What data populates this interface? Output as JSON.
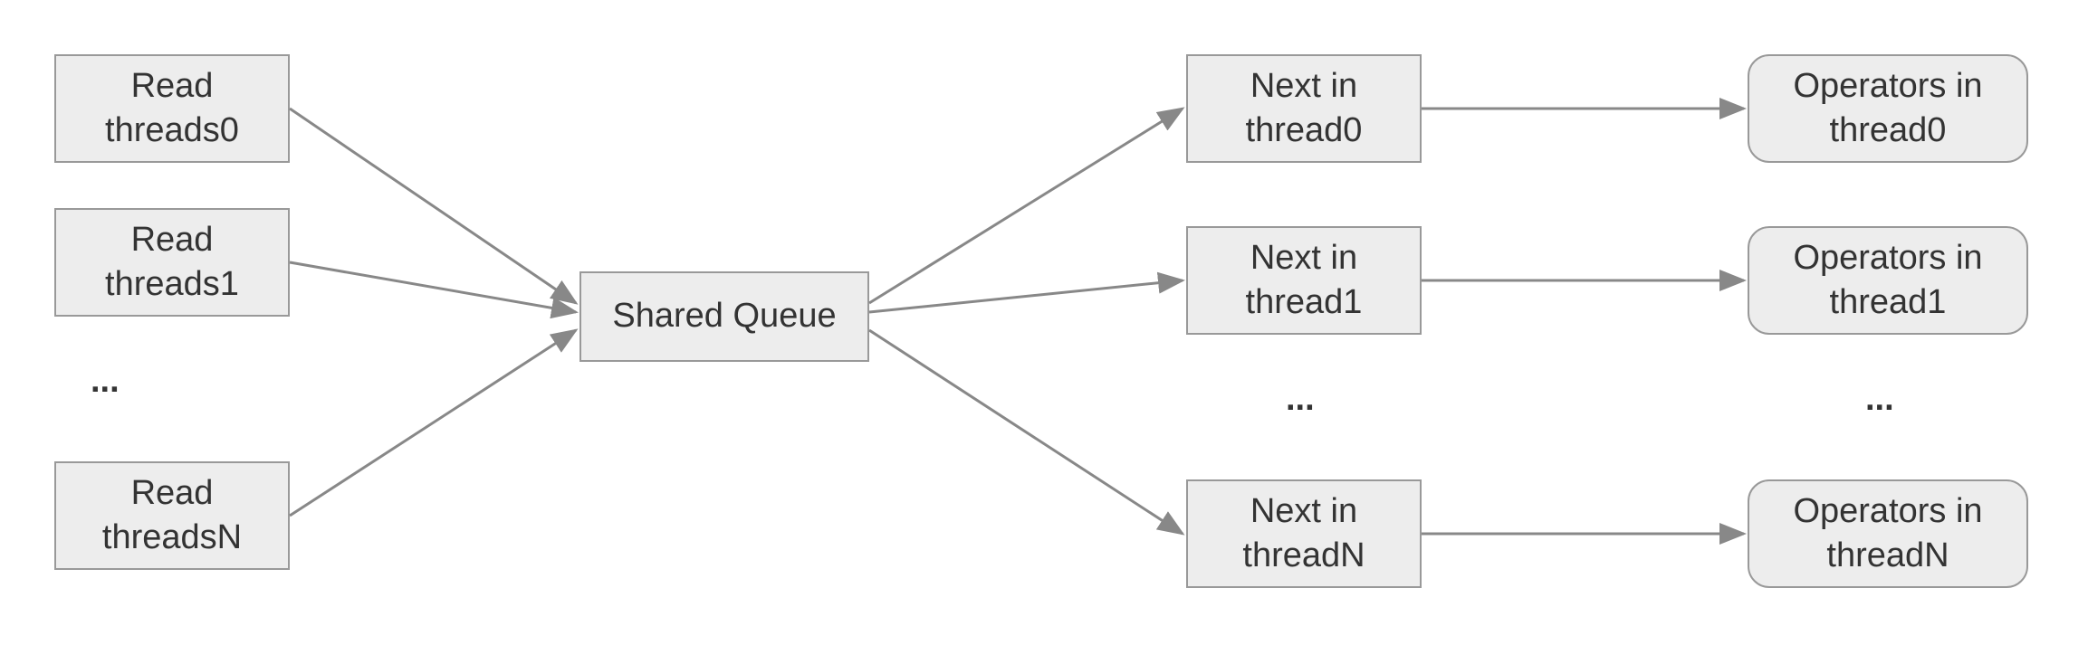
{
  "read_column": {
    "items": [
      {
        "line1": "Read",
        "line2": "threads0"
      },
      {
        "line1": "Read",
        "line2": "threads1"
      },
      {
        "line1": "Read",
        "line2": "threadsN"
      }
    ],
    "ellipsis": "..."
  },
  "center_box": {
    "label": "Shared Queue"
  },
  "next_column": {
    "items": [
      {
        "line1": "Next in",
        "line2": "thread0"
      },
      {
        "line1": "Next in",
        "line2": "thread1"
      },
      {
        "line1": "Next in",
        "line2": "threadN"
      }
    ],
    "ellipsis": "..."
  },
  "operators_column": {
    "items": [
      {
        "line1": "Operators in",
        "line2": "thread0"
      },
      {
        "line1": "Operators in",
        "line2": "thread1"
      },
      {
        "line1": "Operators in",
        "line2": "threadN"
      }
    ],
    "ellipsis": "..."
  }
}
